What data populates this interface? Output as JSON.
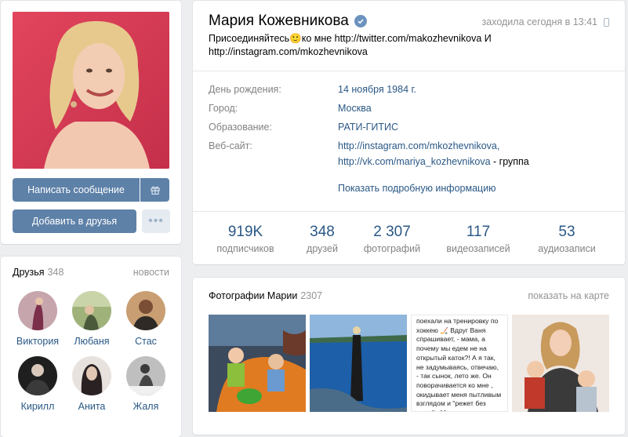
{
  "profile": {
    "name": "Мария Кожевникова",
    "last_seen": "заходила сегодня в 13:41",
    "status_line1": "Присоединяйтесь🙂ко мне http://twitter.com/makozhevnikova И",
    "status_line2": "http://instagram.com/mkozhevnikova"
  },
  "buttons": {
    "message": "Написать сообщение",
    "add_friend": "Добавить в друзья",
    "more": "•••"
  },
  "info": {
    "birthday_label": "День рождения:",
    "birthday_value": "14 ноября 1984 г.",
    "city_label": "Город:",
    "city_value": "Москва",
    "education_label": "Образование:",
    "education_value": "РАТИ-ГИТИС",
    "website_label": "Веб-сайт:",
    "website_value1": "http://instagram.com/mkozhevnikova,",
    "website_value2_link": "http://vk.com/mariya_kozhevnikova",
    "website_value2_suffix": " - группа",
    "more_info": "Показать подробную информацию"
  },
  "stats": [
    {
      "value": "919K",
      "label": "подписчиков"
    },
    {
      "value": "348",
      "label": "друзей"
    },
    {
      "value": "2 307",
      "label": "фотографий"
    },
    {
      "value": "117",
      "label": "видеозаписей"
    },
    {
      "value": "53",
      "label": "аудиозаписи"
    }
  ],
  "friends": {
    "title": "Друзья",
    "count": "348",
    "news_link": "новости",
    "items": [
      {
        "name": "Виктория",
        "color": "#b9909a"
      },
      {
        "name": "Любаня",
        "color": "#8e9a6a"
      },
      {
        "name": "Стас",
        "color": "#a07a55"
      },
      {
        "name": "Кирилл",
        "color": "#2b2b2b"
      },
      {
        "name": "Анита",
        "color": "#3c3434"
      },
      {
        "name": "Жаля",
        "color": "#6b6b6b"
      }
    ]
  },
  "photos": {
    "title": "Фотографии Марии",
    "count": "2307",
    "map_link": "показать на карте",
    "text_photo": "поехали на тренировку по хоккею 🏒 Вдруг Ваня спрашивает, - мама, а почему мы едем не на открытый каток?! А я так, не задумываясь, отвечаю, - так сынок, лето же. Он поворачивается ко мне , окидывает меня пытливым взглядом и \"режет без ножа\" - Мама, а почему я тогда в шапке?! 😂😂 Больше маме"
  },
  "colors": {
    "accent": "#5e81a8",
    "link": "#2a5885",
    "background": "#edeef0",
    "verified": "#6c92be"
  }
}
